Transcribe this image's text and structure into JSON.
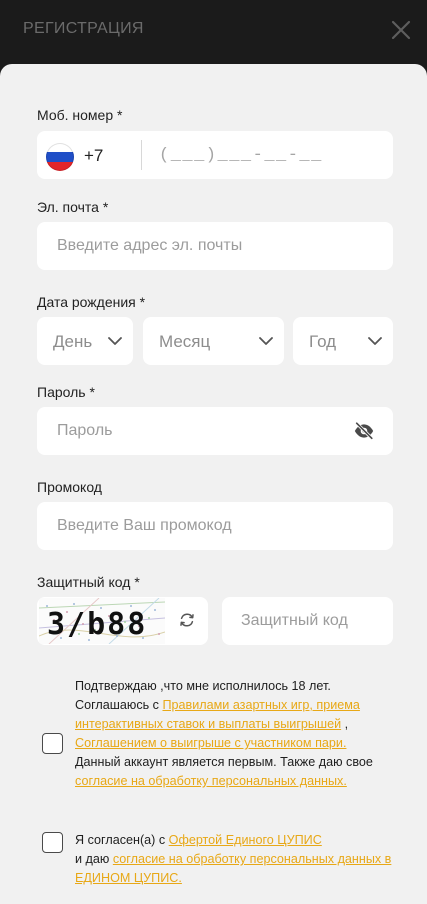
{
  "header": {
    "title": "РЕГИСТРАЦИЯ"
  },
  "phone": {
    "label": "Моб. номер *",
    "country_code": "+7",
    "mask": "(___)___-__-__"
  },
  "email": {
    "label": "Эл. почта *",
    "placeholder": "Введите адрес эл. почты"
  },
  "birthdate": {
    "label": "Дата рождения *",
    "day_placeholder": "День",
    "month_placeholder": "Месяц",
    "year_placeholder": "Год"
  },
  "password": {
    "label": "Пароль *",
    "placeholder": "Пароль"
  },
  "promo": {
    "label": "Промокод",
    "placeholder": "Введите Ваш промокод"
  },
  "captcha": {
    "label": "Защитный код *",
    "image_text": "3/b88",
    "placeholder": "Защитный код"
  },
  "consent1": {
    "line1": "Подтверждаю ,что мне исполнилось 18 лет.",
    "prefix": "Соглашаюсь с ",
    "link_rules": "Правилами азартных игр, приема интерактивных ставок и выплаты выигрышей",
    "sep": " , ",
    "link_agreement": "Соглашением о выигрыше с участником пари.",
    "mid": " Данный аккаунт является первым. Также даю свое ",
    "link_consent": "согласие на обработку персональных данных."
  },
  "consent2": {
    "prefix": "Я согласен(а) с ",
    "link_offer": "Офертой Единого ЦУПИС",
    "mid": " и даю ",
    "link_consent": "согласие на обработку персональных данных в ЕДИНОМ ЦУПИС."
  },
  "colors": {
    "accent_link": "#e8a816",
    "header_bg": "#1b1b1b",
    "sheet_bg": "#f1f1f1"
  }
}
